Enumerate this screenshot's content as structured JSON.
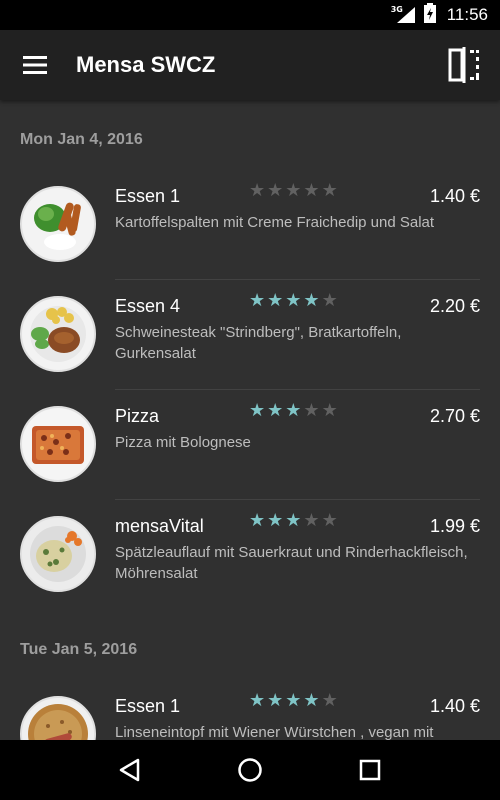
{
  "status_bar": {
    "network": "3G",
    "time": "11:56"
  },
  "app_bar": {
    "title": "Mensa SWCZ",
    "menu_icon": "hamburger-menu-icon",
    "compare_icon": "split-view-icon"
  },
  "days": [
    {
      "date": "Mon Jan 4, 2016",
      "meals": [
        {
          "name": "Essen 1",
          "rating": 0,
          "price": "1.40 €",
          "description": "Kartoffelspalten mit Creme Fraichedip und Salat"
        },
        {
          "name": "Essen 4",
          "rating": 4,
          "price": "2.20 €",
          "description": "Schweinesteak \"Strindberg\", Bratkartoffeln, Gurkensalat"
        },
        {
          "name": "Pizza",
          "rating": 3,
          "price": "2.70 €",
          "description": "Pizza mit Bolognese"
        },
        {
          "name": "mensaVital",
          "rating": 3,
          "price": "1.99 €",
          "description": "Spätzleauflauf mit Sauerkraut und Rinderhackfleisch, Möhrensalat"
        }
      ]
    },
    {
      "date": "Tue Jan 5, 2016",
      "meals": [
        {
          "name": "Essen 1",
          "rating": 4,
          "price": "1.40 €",
          "description": "Linseneintopf mit Wiener Würstchen , vegan mit Dessert und Roggenbrot"
        }
      ]
    }
  ],
  "colors": {
    "star_on": "#7fc4c6",
    "star_off": "#616161",
    "background": "#303030",
    "app_bar": "#212121"
  },
  "nav": {
    "back_icon": "back-triangle-icon",
    "home_icon": "home-circle-icon",
    "recents_icon": "recents-square-icon"
  }
}
